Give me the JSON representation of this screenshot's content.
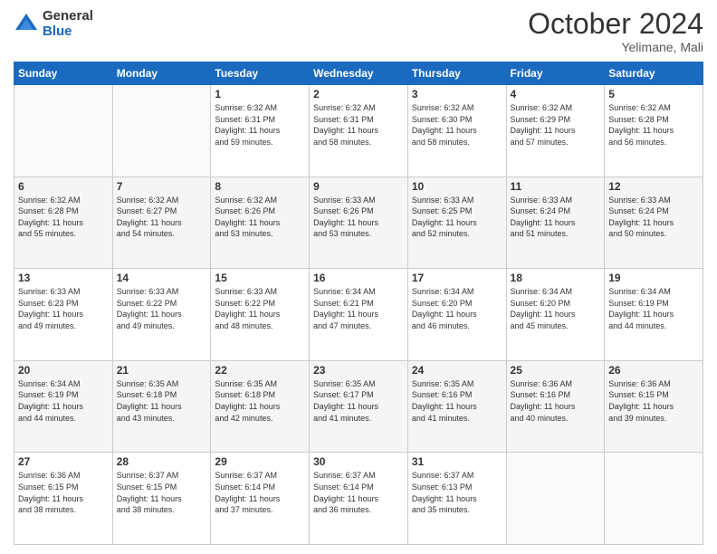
{
  "header": {
    "logo_general": "General",
    "logo_blue": "Blue",
    "month_title": "October 2024",
    "location": "Yelimane, Mali"
  },
  "days_of_week": [
    "Sunday",
    "Monday",
    "Tuesday",
    "Wednesday",
    "Thursday",
    "Friday",
    "Saturday"
  ],
  "weeks": [
    {
      "alt": false,
      "days": [
        {
          "num": "",
          "info": ""
        },
        {
          "num": "",
          "info": ""
        },
        {
          "num": "1",
          "info": "Sunrise: 6:32 AM\nSunset: 6:31 PM\nDaylight: 11 hours\nand 59 minutes."
        },
        {
          "num": "2",
          "info": "Sunrise: 6:32 AM\nSunset: 6:31 PM\nDaylight: 11 hours\nand 58 minutes."
        },
        {
          "num": "3",
          "info": "Sunrise: 6:32 AM\nSunset: 6:30 PM\nDaylight: 11 hours\nand 58 minutes."
        },
        {
          "num": "4",
          "info": "Sunrise: 6:32 AM\nSunset: 6:29 PM\nDaylight: 11 hours\nand 57 minutes."
        },
        {
          "num": "5",
          "info": "Sunrise: 6:32 AM\nSunset: 6:28 PM\nDaylight: 11 hours\nand 56 minutes."
        }
      ]
    },
    {
      "alt": true,
      "days": [
        {
          "num": "6",
          "info": "Sunrise: 6:32 AM\nSunset: 6:28 PM\nDaylight: 11 hours\nand 55 minutes."
        },
        {
          "num": "7",
          "info": "Sunrise: 6:32 AM\nSunset: 6:27 PM\nDaylight: 11 hours\nand 54 minutes."
        },
        {
          "num": "8",
          "info": "Sunrise: 6:32 AM\nSunset: 6:26 PM\nDaylight: 11 hours\nand 53 minutes."
        },
        {
          "num": "9",
          "info": "Sunrise: 6:33 AM\nSunset: 6:26 PM\nDaylight: 11 hours\nand 53 minutes."
        },
        {
          "num": "10",
          "info": "Sunrise: 6:33 AM\nSunset: 6:25 PM\nDaylight: 11 hours\nand 52 minutes."
        },
        {
          "num": "11",
          "info": "Sunrise: 6:33 AM\nSunset: 6:24 PM\nDaylight: 11 hours\nand 51 minutes."
        },
        {
          "num": "12",
          "info": "Sunrise: 6:33 AM\nSunset: 6:24 PM\nDaylight: 11 hours\nand 50 minutes."
        }
      ]
    },
    {
      "alt": false,
      "days": [
        {
          "num": "13",
          "info": "Sunrise: 6:33 AM\nSunset: 6:23 PM\nDaylight: 11 hours\nand 49 minutes."
        },
        {
          "num": "14",
          "info": "Sunrise: 6:33 AM\nSunset: 6:22 PM\nDaylight: 11 hours\nand 49 minutes."
        },
        {
          "num": "15",
          "info": "Sunrise: 6:33 AM\nSunset: 6:22 PM\nDaylight: 11 hours\nand 48 minutes."
        },
        {
          "num": "16",
          "info": "Sunrise: 6:34 AM\nSunset: 6:21 PM\nDaylight: 11 hours\nand 47 minutes."
        },
        {
          "num": "17",
          "info": "Sunrise: 6:34 AM\nSunset: 6:20 PM\nDaylight: 11 hours\nand 46 minutes."
        },
        {
          "num": "18",
          "info": "Sunrise: 6:34 AM\nSunset: 6:20 PM\nDaylight: 11 hours\nand 45 minutes."
        },
        {
          "num": "19",
          "info": "Sunrise: 6:34 AM\nSunset: 6:19 PM\nDaylight: 11 hours\nand 44 minutes."
        }
      ]
    },
    {
      "alt": true,
      "days": [
        {
          "num": "20",
          "info": "Sunrise: 6:34 AM\nSunset: 6:19 PM\nDaylight: 11 hours\nand 44 minutes."
        },
        {
          "num": "21",
          "info": "Sunrise: 6:35 AM\nSunset: 6:18 PM\nDaylight: 11 hours\nand 43 minutes."
        },
        {
          "num": "22",
          "info": "Sunrise: 6:35 AM\nSunset: 6:18 PM\nDaylight: 11 hours\nand 42 minutes."
        },
        {
          "num": "23",
          "info": "Sunrise: 6:35 AM\nSunset: 6:17 PM\nDaylight: 11 hours\nand 41 minutes."
        },
        {
          "num": "24",
          "info": "Sunrise: 6:35 AM\nSunset: 6:16 PM\nDaylight: 11 hours\nand 41 minutes."
        },
        {
          "num": "25",
          "info": "Sunrise: 6:36 AM\nSunset: 6:16 PM\nDaylight: 11 hours\nand 40 minutes."
        },
        {
          "num": "26",
          "info": "Sunrise: 6:36 AM\nSunset: 6:15 PM\nDaylight: 11 hours\nand 39 minutes."
        }
      ]
    },
    {
      "alt": false,
      "days": [
        {
          "num": "27",
          "info": "Sunrise: 6:36 AM\nSunset: 6:15 PM\nDaylight: 11 hours\nand 38 minutes."
        },
        {
          "num": "28",
          "info": "Sunrise: 6:37 AM\nSunset: 6:15 PM\nDaylight: 11 hours\nand 38 minutes."
        },
        {
          "num": "29",
          "info": "Sunrise: 6:37 AM\nSunset: 6:14 PM\nDaylight: 11 hours\nand 37 minutes."
        },
        {
          "num": "30",
          "info": "Sunrise: 6:37 AM\nSunset: 6:14 PM\nDaylight: 11 hours\nand 36 minutes."
        },
        {
          "num": "31",
          "info": "Sunrise: 6:37 AM\nSunset: 6:13 PM\nDaylight: 11 hours\nand 35 minutes."
        },
        {
          "num": "",
          "info": ""
        },
        {
          "num": "",
          "info": ""
        }
      ]
    }
  ]
}
